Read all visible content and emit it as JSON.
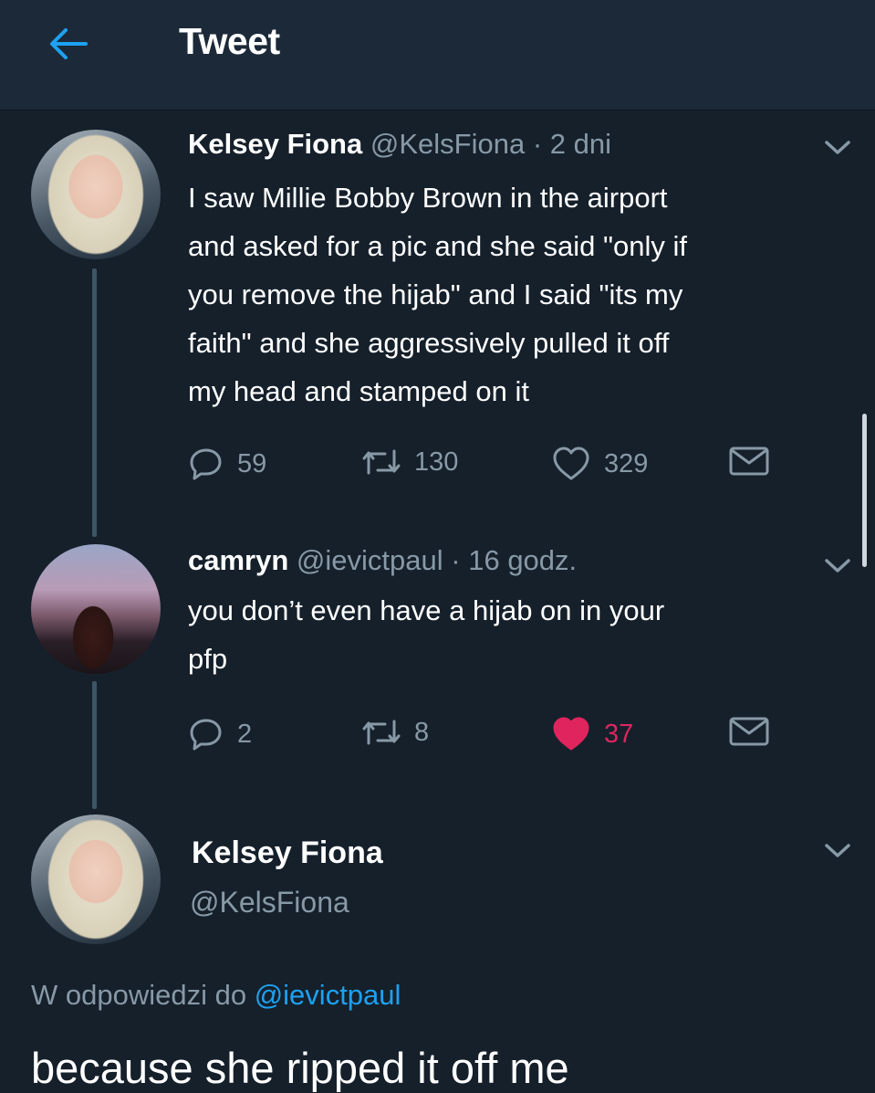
{
  "header": {
    "title": "Tweet",
    "back_icon": "arrow-left-icon"
  },
  "colors": {
    "background": "#15202b",
    "header": "#1c2938",
    "muted": "#8899a6",
    "accent": "#1da1f2",
    "like": "#e0245e"
  },
  "tweets": [
    {
      "name": "Kelsey Fiona",
      "handle": "@KelsFiona",
      "separator": "·",
      "time": "2 dni",
      "text_lines": [
        "I saw Millie Bobby Brown in the airport",
        "and asked for a pic and she said \"only if",
        "you remove the hijab\" and I said \"its my",
        "faith\" and she aggressively pulled it off",
        "my head and stamped on it"
      ],
      "replies": "59",
      "retweets": "130",
      "likes": "329",
      "liked": false
    },
    {
      "name": "camryn",
      "handle": "@ievictpaul",
      "separator": "·",
      "time": "16 godz.",
      "text_lines": [
        "you don’t even have a hijab on in your",
        "pfp"
      ],
      "replies": "2",
      "retweets": "8",
      "likes": "37",
      "liked": true
    }
  ],
  "focused": {
    "name": "Kelsey Fiona",
    "handle": "@KelsFiona",
    "reply_prefix": "W odpowiedzi do",
    "reply_mention": "@ievictpaul",
    "text": "because she ripped it off me"
  }
}
